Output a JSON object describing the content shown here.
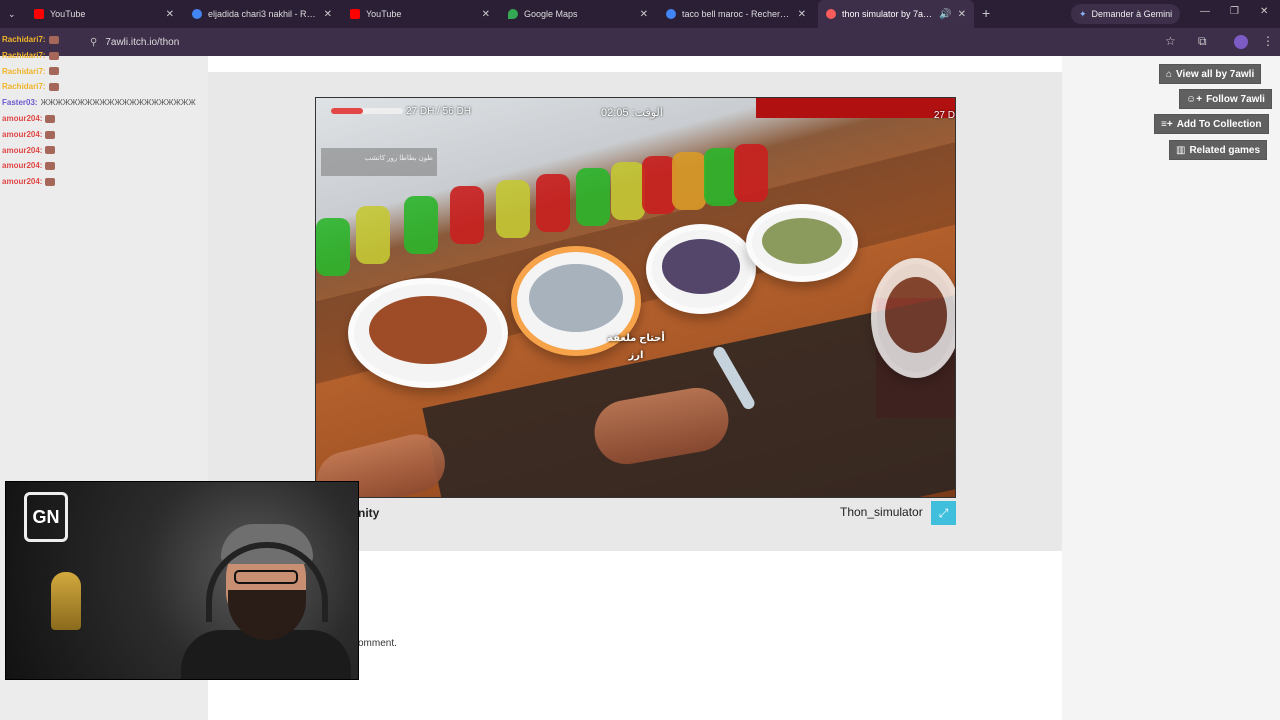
{
  "browser": {
    "tabs": [
      {
        "title": "YouTube",
        "favicon_color": "#ff0000"
      },
      {
        "title": "eljadida chari3 nakhil - Recherche",
        "favicon_color": "#4285f4"
      },
      {
        "title": "YouTube",
        "favicon_color": "#ff0000"
      },
      {
        "title": "Google Maps",
        "favicon_color": "#34a853"
      },
      {
        "title": "taco bell maroc - Recherche Go",
        "favicon_color": "#4285f4"
      },
      {
        "title": "thon simulator by 7awli",
        "favicon_color": "#fa5c5c",
        "active": true
      }
    ],
    "gemini_label": "Demander à Gemini",
    "url": "7awli.itch.io/thon"
  },
  "game": {
    "hud": {
      "money": "27 DH / 56 DH",
      "timer": "الوقت: 02:05",
      "money_right": "27 D",
      "health_fraction": 0.45,
      "task": "طون بطاطا رور كاتشب",
      "prompt_line1": "أحتاج ملعقة",
      "prompt_line2": "ارز"
    },
    "engine_logo": "nity",
    "title": "Thon_simulator",
    "fullscreen_icon": "expand-icon"
  },
  "page": {
    "comment_text": "omment."
  },
  "sidebar": {
    "view_all": "View all by 7awli",
    "follow": "Follow 7awli",
    "add_collection": "Add To Collection",
    "related": "Related games"
  },
  "chat": [
    {
      "user": "Rachidari7:",
      "color": "#f0b429"
    },
    {
      "user": "Rachidari7:",
      "color": "#f0b429"
    },
    {
      "user": "Rachidari7:",
      "color": "#f0b429"
    },
    {
      "user": "Rachidari7:",
      "color": "#f0b429"
    },
    {
      "user": "Faster03:",
      "color": "#6a5acd",
      "message": "ЖЖЖЖЖЖЖЖЖЖЖЖЖЖЖЖЖЖЖЖЖ"
    },
    {
      "user": "amour204:",
      "color": "#e04848"
    },
    {
      "user": "amour204:",
      "color": "#e04848"
    },
    {
      "user": "amour204:",
      "color": "#e04848"
    },
    {
      "user": "amour204:",
      "color": "#e04848"
    },
    {
      "user": "amour204:",
      "color": "#e04848"
    }
  ],
  "webcam": {
    "logo_text": "GN"
  }
}
